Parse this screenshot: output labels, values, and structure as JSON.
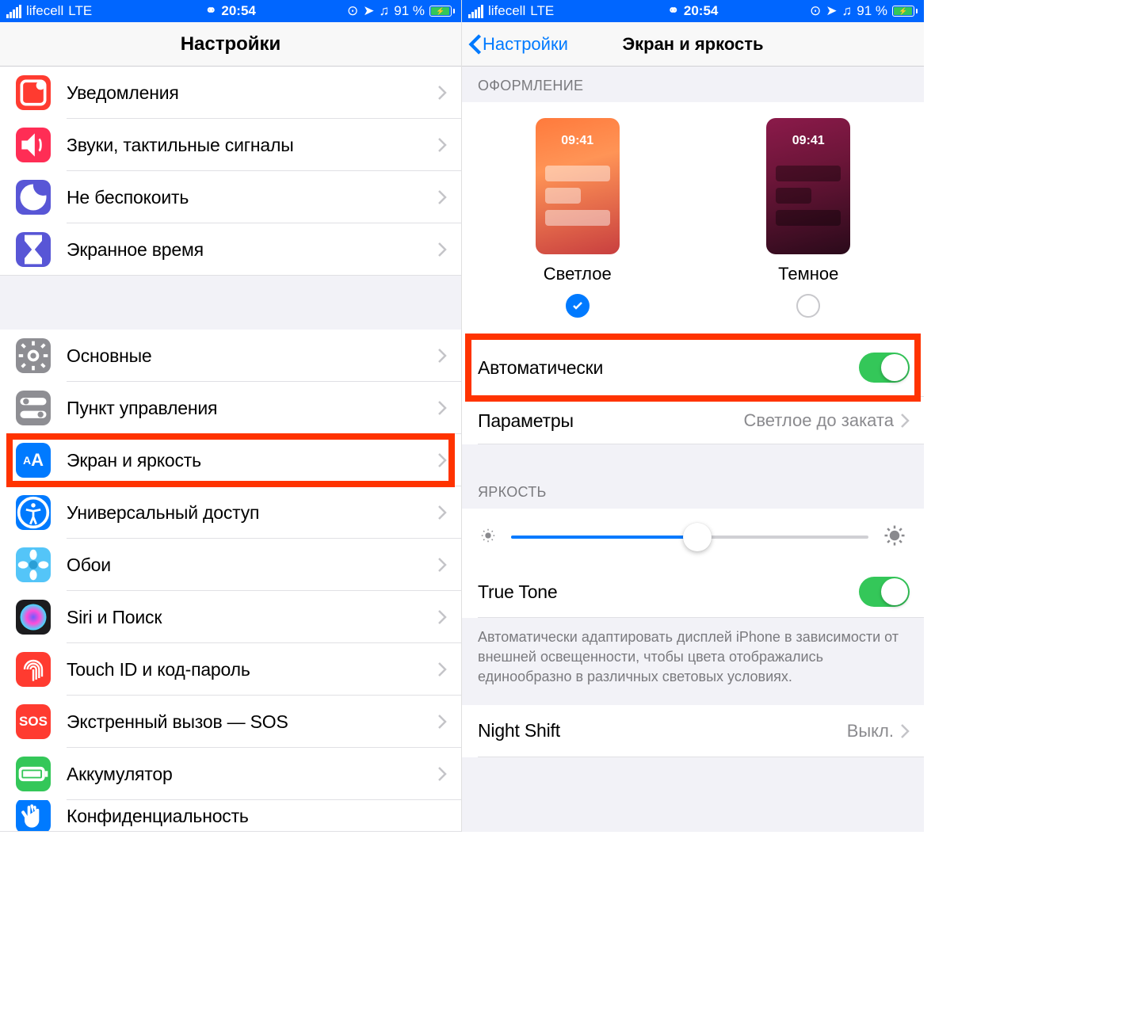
{
  "status": {
    "carrier": "lifecell",
    "network": "LTE",
    "time": "20:54",
    "battery_pct": "91 %"
  },
  "left": {
    "title": "Настройки",
    "group1": [
      {
        "label": "Уведомления",
        "icon": "notifications"
      },
      {
        "label": "Звуки, тактильные сигналы",
        "icon": "sounds"
      },
      {
        "label": "Не беспокоить",
        "icon": "dnd"
      },
      {
        "label": "Экранное время",
        "icon": "screentime"
      }
    ],
    "group2": [
      {
        "label": "Основные",
        "icon": "general"
      },
      {
        "label": "Пункт управления",
        "icon": "control"
      },
      {
        "label": "Экран и яркость",
        "icon": "display",
        "highlighted": true
      },
      {
        "label": "Универсальный доступ",
        "icon": "accessibility"
      },
      {
        "label": "Обои",
        "icon": "wallpaper"
      },
      {
        "label": "Siri и Поиск",
        "icon": "siri"
      },
      {
        "label": "Touch ID и код-пароль",
        "icon": "touchid"
      },
      {
        "label": "Экстренный вызов — SOS",
        "icon": "sos"
      },
      {
        "label": "Аккумулятор",
        "icon": "battery"
      },
      {
        "label": "Конфиденциальность",
        "icon": "privacy"
      }
    ]
  },
  "right": {
    "back": "Настройки",
    "title": "Экран и яркость",
    "section_appearance": "ОФОРМЛЕНИЕ",
    "preview_time": "09:41",
    "light": "Светлое",
    "dark": "Темное",
    "auto": "Автоматически",
    "options": "Параметры",
    "options_val": "Светлое до заката",
    "section_brightness": "ЯРКОСТЬ",
    "truetone": "True Tone",
    "truetone_desc": "Автоматически адаптировать дисплей iPhone в зависимости от внешней освещенности, чтобы цвета отображались единообразно в различных световых условиях.",
    "nightshift": "Night Shift",
    "nightshift_val": "Выкл."
  }
}
